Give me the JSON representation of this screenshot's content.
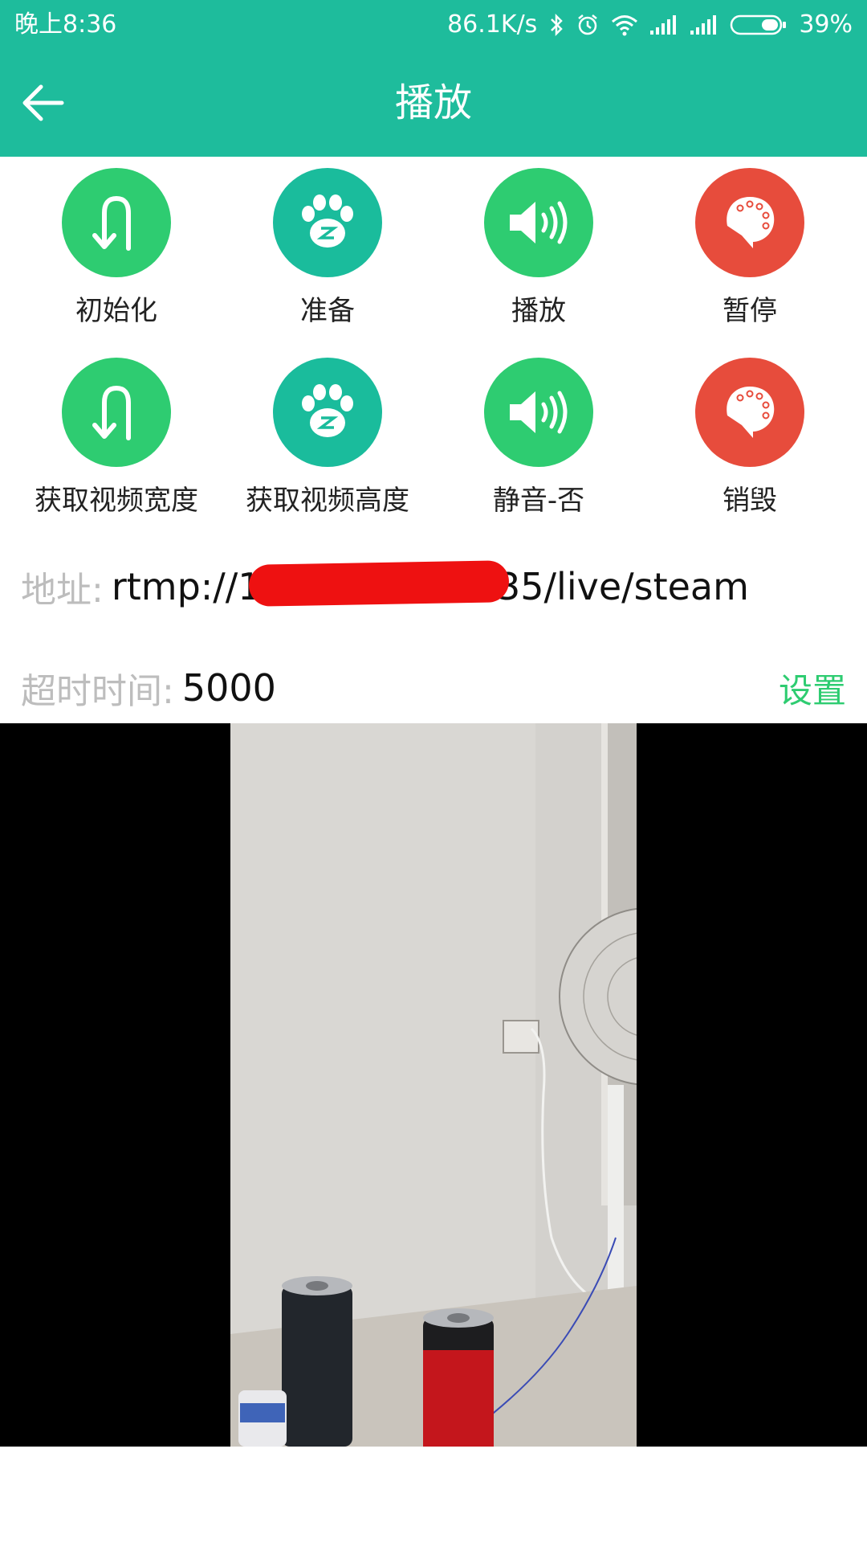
{
  "status_bar": {
    "time": "晚上8:36",
    "network_speed": "86.1K/s",
    "battery": "39%",
    "icons": [
      "bluetooth-icon",
      "alarm-icon",
      "wifi-icon",
      "signal-icon",
      "signal-icon",
      "battery-icon"
    ]
  },
  "app_bar": {
    "title": "播放",
    "back_icon": "arrow-left-icon"
  },
  "actions": [
    {
      "label": "初始化",
      "icon": "u-turn-icon",
      "color": "#2ecc71"
    },
    {
      "label": "准备",
      "icon": "paw-icon",
      "color": "#1abc9c"
    },
    {
      "label": "播放",
      "icon": "speaker-icon",
      "color": "#2ecc71"
    },
    {
      "label": "暂停",
      "icon": "palette-icon",
      "color": "#e74c3c"
    },
    {
      "label": "获取视频宽度",
      "icon": "u-turn-icon",
      "color": "#2ecc71"
    },
    {
      "label": "获取视频高度",
      "icon": "paw-icon",
      "color": "#1abc9c"
    },
    {
      "label": "静音-否",
      "icon": "speaker-icon",
      "color": "#2ecc71"
    },
    {
      "label": "销毁",
      "icon": "palette-icon",
      "color": "#e74c3c"
    }
  ],
  "address": {
    "label": "地址:",
    "value": "rtmp://1·1·2·1.1·2:1935/live/steam"
  },
  "timeout": {
    "label": "超时时间:",
    "value": "5000",
    "set_label": "设置"
  },
  "colors": {
    "primary": "#1ebc9c",
    "accent_green": "#2ecc71",
    "accent_red": "#e74c3c"
  }
}
